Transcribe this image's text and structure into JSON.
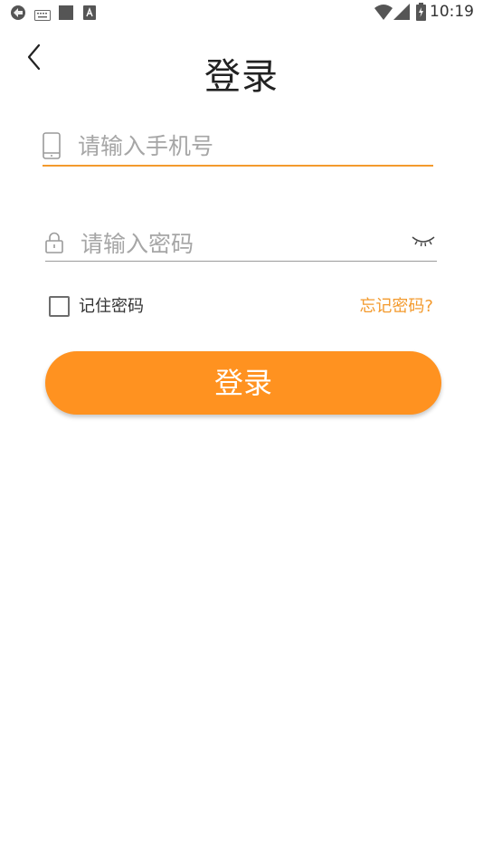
{
  "status_bar": {
    "time": "10:19",
    "icons": [
      "sync-icon",
      "keyboard-icon",
      "square-icon",
      "a-icon",
      "wifi-icon",
      "signal-icon",
      "battery-icon"
    ]
  },
  "header": {
    "title": "登录",
    "back_icon": "chevron-left-icon"
  },
  "form": {
    "phone": {
      "icon": "phone-icon",
      "placeholder": "请输入手机号",
      "value": ""
    },
    "password": {
      "icon": "lock-icon",
      "placeholder": "请输入密码",
      "value": "",
      "toggle_icon": "eye-closed-icon"
    },
    "remember": {
      "label": "记住密码",
      "checked": false
    },
    "forgot_label": "忘记密码?",
    "login_label": "登录"
  },
  "colors": {
    "accent": "#ff9220",
    "link": "#f39a2d",
    "underline_active": "#f39a2d",
    "underline_inactive": "#9a9a9a",
    "placeholder": "#a6a6a6"
  }
}
